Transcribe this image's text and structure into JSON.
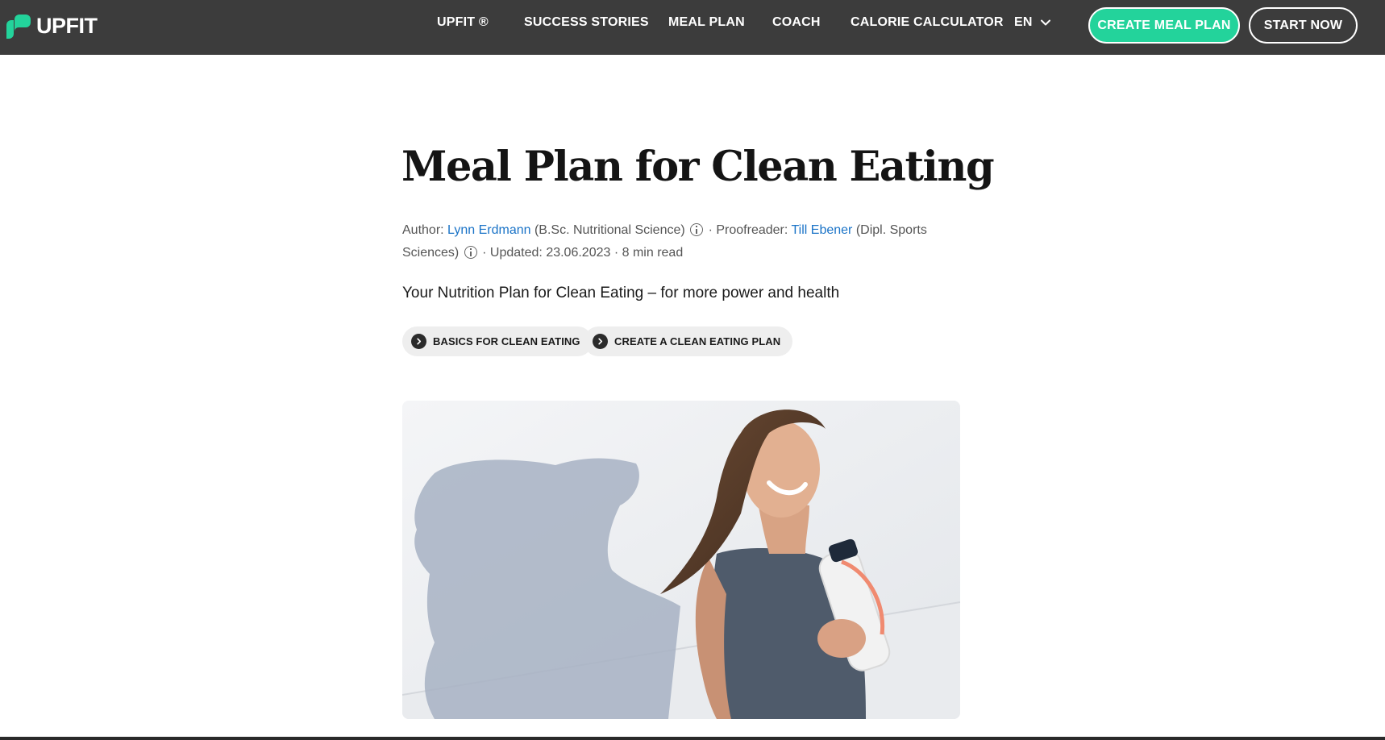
{
  "brand": {
    "name": "UPFIT",
    "accent": "#23d39b",
    "nav_bg": "#3c3c3c",
    "link_color": "#1a73c7"
  },
  "nav": {
    "items": [
      {
        "label": "UPFIT ®"
      },
      {
        "label": "SUCCESS STORIES"
      },
      {
        "label": "MEAL PLAN"
      },
      {
        "label": "COACH"
      },
      {
        "label": "CALORIE CALCULATOR"
      }
    ],
    "language": "EN",
    "cta_primary": "CREATE MEAL PLAN",
    "cta_secondary": "START NOW"
  },
  "article": {
    "title": "Meal Plan for Clean Eating",
    "meta": {
      "author_prefix": "Author:",
      "author_name": "Lynn Erdmann",
      "author_credential": "(B.Sc. Nutritional Science)",
      "proofreader_prefix": "· Proofreader:",
      "proofreader_name": "Till Ebener",
      "proofreader_credential": "(Dipl. Sports Sciences)",
      "updated": "· Updated: 23.06.2023",
      "read_time": "· 8 min read"
    },
    "subtitle": "Your Nutrition Plan for Clean Eating – for more power and health",
    "jump_links": [
      {
        "label": "BASICS FOR CLEAN EATING"
      },
      {
        "label": "CREATE A CLEAN EATING PLAN"
      }
    ],
    "icons": {
      "logo": "upfit-logo-icon",
      "language": "chevron-down-icon",
      "info": "info-icon",
      "jump": "chevron-right-icon"
    }
  }
}
